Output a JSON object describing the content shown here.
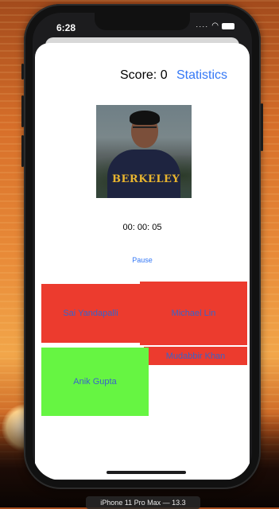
{
  "status_bar": {
    "time": "6:28"
  },
  "header": {
    "score_text": "Score: 0",
    "statistics_label": "Statistics"
  },
  "quiz": {
    "photo_logo_text": "BERKELEY",
    "timer": "00: 00: 05",
    "pause_label": "Pause",
    "options": [
      "Sai Yandapalli",
      "Michael Lin",
      "Mudabbir Khan",
      "Anik Gupta"
    ]
  },
  "device_label": "iPhone 11 Pro Max — 13.3",
  "colors": {
    "accent": "#3478f6",
    "wrong": "#ec3b2e",
    "correct": "#66f542"
  }
}
